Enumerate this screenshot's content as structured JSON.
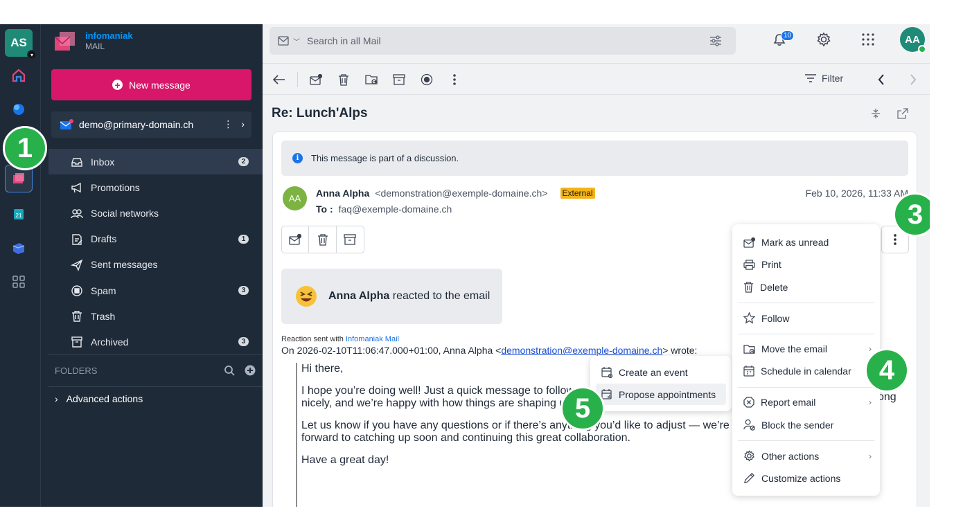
{
  "rail": {
    "avatar_initials": "AS"
  },
  "sidebar": {
    "brand_name": "infomaniak",
    "brand_sub": "MAIL",
    "new_message": "New message",
    "account": "demo@primary-domain.ch",
    "folders": [
      {
        "label": "Inbox",
        "count": "2",
        "icon": "inbox-icon"
      },
      {
        "label": "Promotions",
        "count": "",
        "icon": "megaphone-icon"
      },
      {
        "label": "Social networks",
        "count": "",
        "icon": "people-icon"
      },
      {
        "label": "Drafts",
        "count": "1",
        "icon": "draft-icon"
      },
      {
        "label": "Sent messages",
        "count": "",
        "icon": "send-icon"
      },
      {
        "label": "Spam",
        "count": "3",
        "icon": "spam-icon"
      },
      {
        "label": "Trash",
        "count": "",
        "icon": "trash-icon"
      },
      {
        "label": "Archived",
        "count": "3",
        "icon": "archive-icon"
      }
    ],
    "folders_header": "FOLDERS",
    "advanced_actions": "Advanced actions"
  },
  "header": {
    "search_placeholder": "Search in all Mail",
    "notif_count": "10",
    "user_initials": "AA"
  },
  "toolbar": {
    "filter_label": "Filter"
  },
  "email": {
    "subject": "Re: Lunch'Alps",
    "discussion_note": "This message is part of a discussion.",
    "sender_initials": "AA",
    "sender_name": "Anna Alpha",
    "sender_address": "<demonstration@exemple-domaine.ch>",
    "external_tag": "External",
    "to_label": "To :",
    "to_address": "faq@exemple-domaine.ch",
    "date": "Feb 10, 2026, 11:33 AM",
    "reaction_name": "Anna Alpha",
    "reaction_text": " reacted to the email",
    "reaction_sent_prefix": "Reaction sent with ",
    "reaction_sent_link": "Infomaniak Mail",
    "wrote_prefix": "On 2026-02-10T11:06:47.000+01:00, Anna Alpha <",
    "wrote_email": "demonstration@exemple-domaine.ch",
    "wrote_suffix": "> wrote:",
    "quote": [
      "Hi there,",
      "I hope you’re doing well! Just a quick message to follow",
      "nicely, and we’re happy with how things are shaping u",
      "Let us know if you have any questions or if there’s anything you’d like to adjust — we’re a",
      "forward to catching up soon and continuing this great collaboration.",
      "Have a great day!"
    ],
    "quote_tail": "ong"
  },
  "menu": {
    "items": [
      {
        "label": "Mark as unread",
        "icon": "mark-unread-icon",
        "submenu": false
      },
      {
        "label": "Print",
        "icon": "print-icon",
        "submenu": false
      },
      {
        "label": "Delete",
        "icon": "trash-icon",
        "submenu": false
      },
      {
        "label": "Follow",
        "icon": "star-icon",
        "submenu": false
      },
      {
        "label": "Move the email",
        "icon": "move-folder-icon",
        "submenu": true
      },
      {
        "label": "Schedule in calendar",
        "icon": "calendar-icon",
        "submenu": true
      },
      {
        "label": "Report email",
        "icon": "report-icon",
        "submenu": true
      },
      {
        "label": "Block the sender",
        "icon": "block-user-icon",
        "submenu": false
      },
      {
        "label": "Other actions",
        "icon": "gear-icon",
        "submenu": true
      },
      {
        "label": "Customize actions",
        "icon": "pencil-icon",
        "submenu": false
      }
    ]
  },
  "submenu": {
    "items": [
      {
        "label": "Create an event",
        "icon": "calendar-plus-icon"
      },
      {
        "label": "Propose appointments",
        "icon": "calendar-poll-icon"
      }
    ]
  },
  "callouts": [
    "1",
    "3",
    "4",
    "5"
  ],
  "colors": {
    "accent": "#d8166a",
    "sidebar": "#1f2a38",
    "callout": "#28b14b",
    "external": "#f3b31a"
  }
}
